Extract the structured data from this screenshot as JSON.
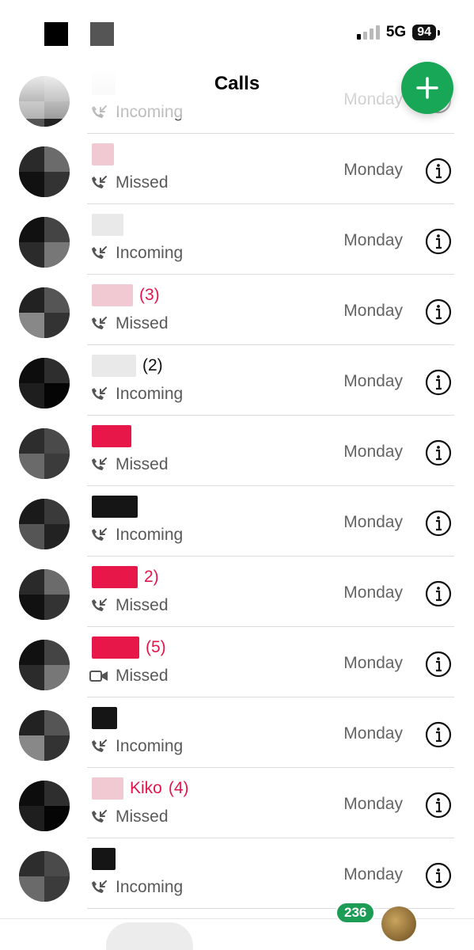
{
  "status_bar": {
    "network": "5G",
    "battery": "94"
  },
  "header": {
    "title": "Calls"
  },
  "calls": [
    {
      "count": "",
      "type": "Incoming",
      "date": "Monday",
      "missed": false
    },
    {
      "count": "",
      "type": "Missed",
      "date": "Monday",
      "missed": true
    },
    {
      "count": "",
      "type": "Incoming",
      "date": "Monday",
      "missed": false
    },
    {
      "count": "(3)",
      "type": "Missed",
      "date": "Monday",
      "missed": true
    },
    {
      "count": "(2)",
      "type": "Incoming",
      "date": "Monday",
      "missed": false
    },
    {
      "count": "",
      "type": "Missed",
      "date": "Monday",
      "missed": true
    },
    {
      "count": "",
      "type": "Incoming",
      "date": "Monday",
      "missed": false
    },
    {
      "count": "2)",
      "type": "Missed",
      "date": "Monday",
      "missed": true
    },
    {
      "count": "(5)",
      "type": "Missed",
      "date": "Monday",
      "missed": true,
      "video": true
    },
    {
      "count": "",
      "type": "Incoming",
      "date": "Monday",
      "missed": false
    },
    {
      "count": "(4)",
      "name_fragment": "Kiko",
      "type": "Missed",
      "date": "Monday",
      "missed": true
    },
    {
      "count": "",
      "type": "Incoming",
      "date": "Monday",
      "missed": false
    }
  ],
  "tab_bar": {
    "chats_badge": "236"
  },
  "colors": {
    "accent": "#18a757",
    "missed": "#e5154b",
    "secondary_text": "#646464"
  }
}
